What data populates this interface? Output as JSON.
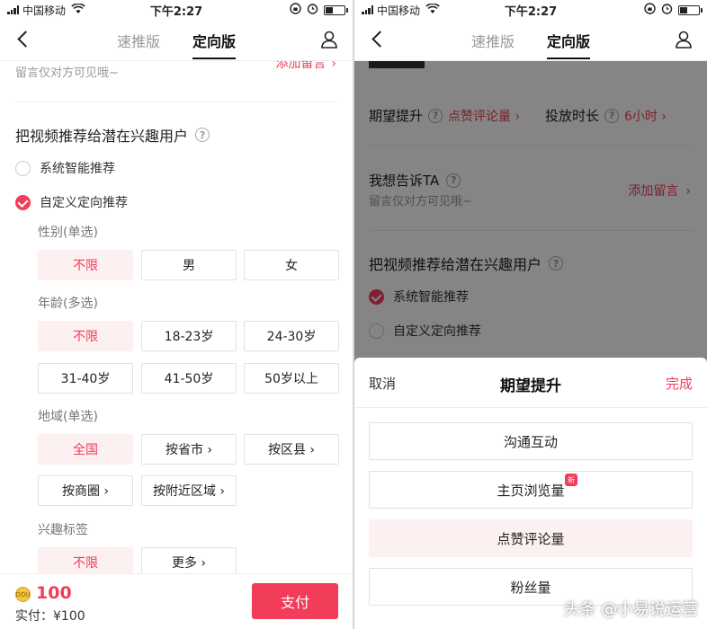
{
  "status": {
    "carrier": "中国移动",
    "time": "下午2:27"
  },
  "nav": {
    "tab_fast": "速推版",
    "tab_targeted": "定向版"
  },
  "left": {
    "leave_msg_hint": "留言仅对方可见哦~",
    "add_msg_link": "添加留言",
    "recommend_title": "把视频推荐给潜在兴趣用户",
    "radio_smart": "系统智能推荐",
    "radio_custom": "自定义定向推荐",
    "gender": {
      "label": "性别(单选)",
      "options": [
        "不限",
        "男",
        "女"
      ]
    },
    "age": {
      "label": "年龄(多选)",
      "options": [
        "不限",
        "18-23岁",
        "24-30岁",
        "31-40岁",
        "41-50岁",
        "50岁以上"
      ]
    },
    "region": {
      "label": "地域(单选)",
      "options": [
        "全国",
        "按省市 ›",
        "按区县 ›",
        "按商圈 ›",
        "按附近区域 ›"
      ]
    },
    "interest": {
      "label": "兴趣标签",
      "options": [
        "不限",
        "更多 ›"
      ]
    },
    "bottom": {
      "coin_text": "DOU",
      "amount": "100",
      "paid": "实付：¥100",
      "pay_button": "支付"
    }
  },
  "right": {
    "expect_label": "期望提升",
    "expect_value": "点赞评论量 ›",
    "duration_label": "投放时长",
    "duration_value": "6小时 ›",
    "tell_label": "我想告诉TA",
    "leave_msg_hint": "留言仅对方可见哦~",
    "add_msg_link": "添加留言",
    "recommend_title": "把视频推荐给潜在兴趣用户",
    "radio_smart": "系统智能推荐",
    "radio_custom": "自定义定向推荐",
    "sheet": {
      "cancel": "取消",
      "title": "期望提升",
      "done": "完成",
      "options": [
        "沟通互动",
        "主页浏览量",
        "点赞评论量",
        "粉丝量"
      ],
      "new_badge": "新"
    },
    "watermark": "头条 @小易说运营"
  },
  "colors": {
    "accent": "#f13c5a",
    "selected_bg": "#fdf0f1"
  }
}
